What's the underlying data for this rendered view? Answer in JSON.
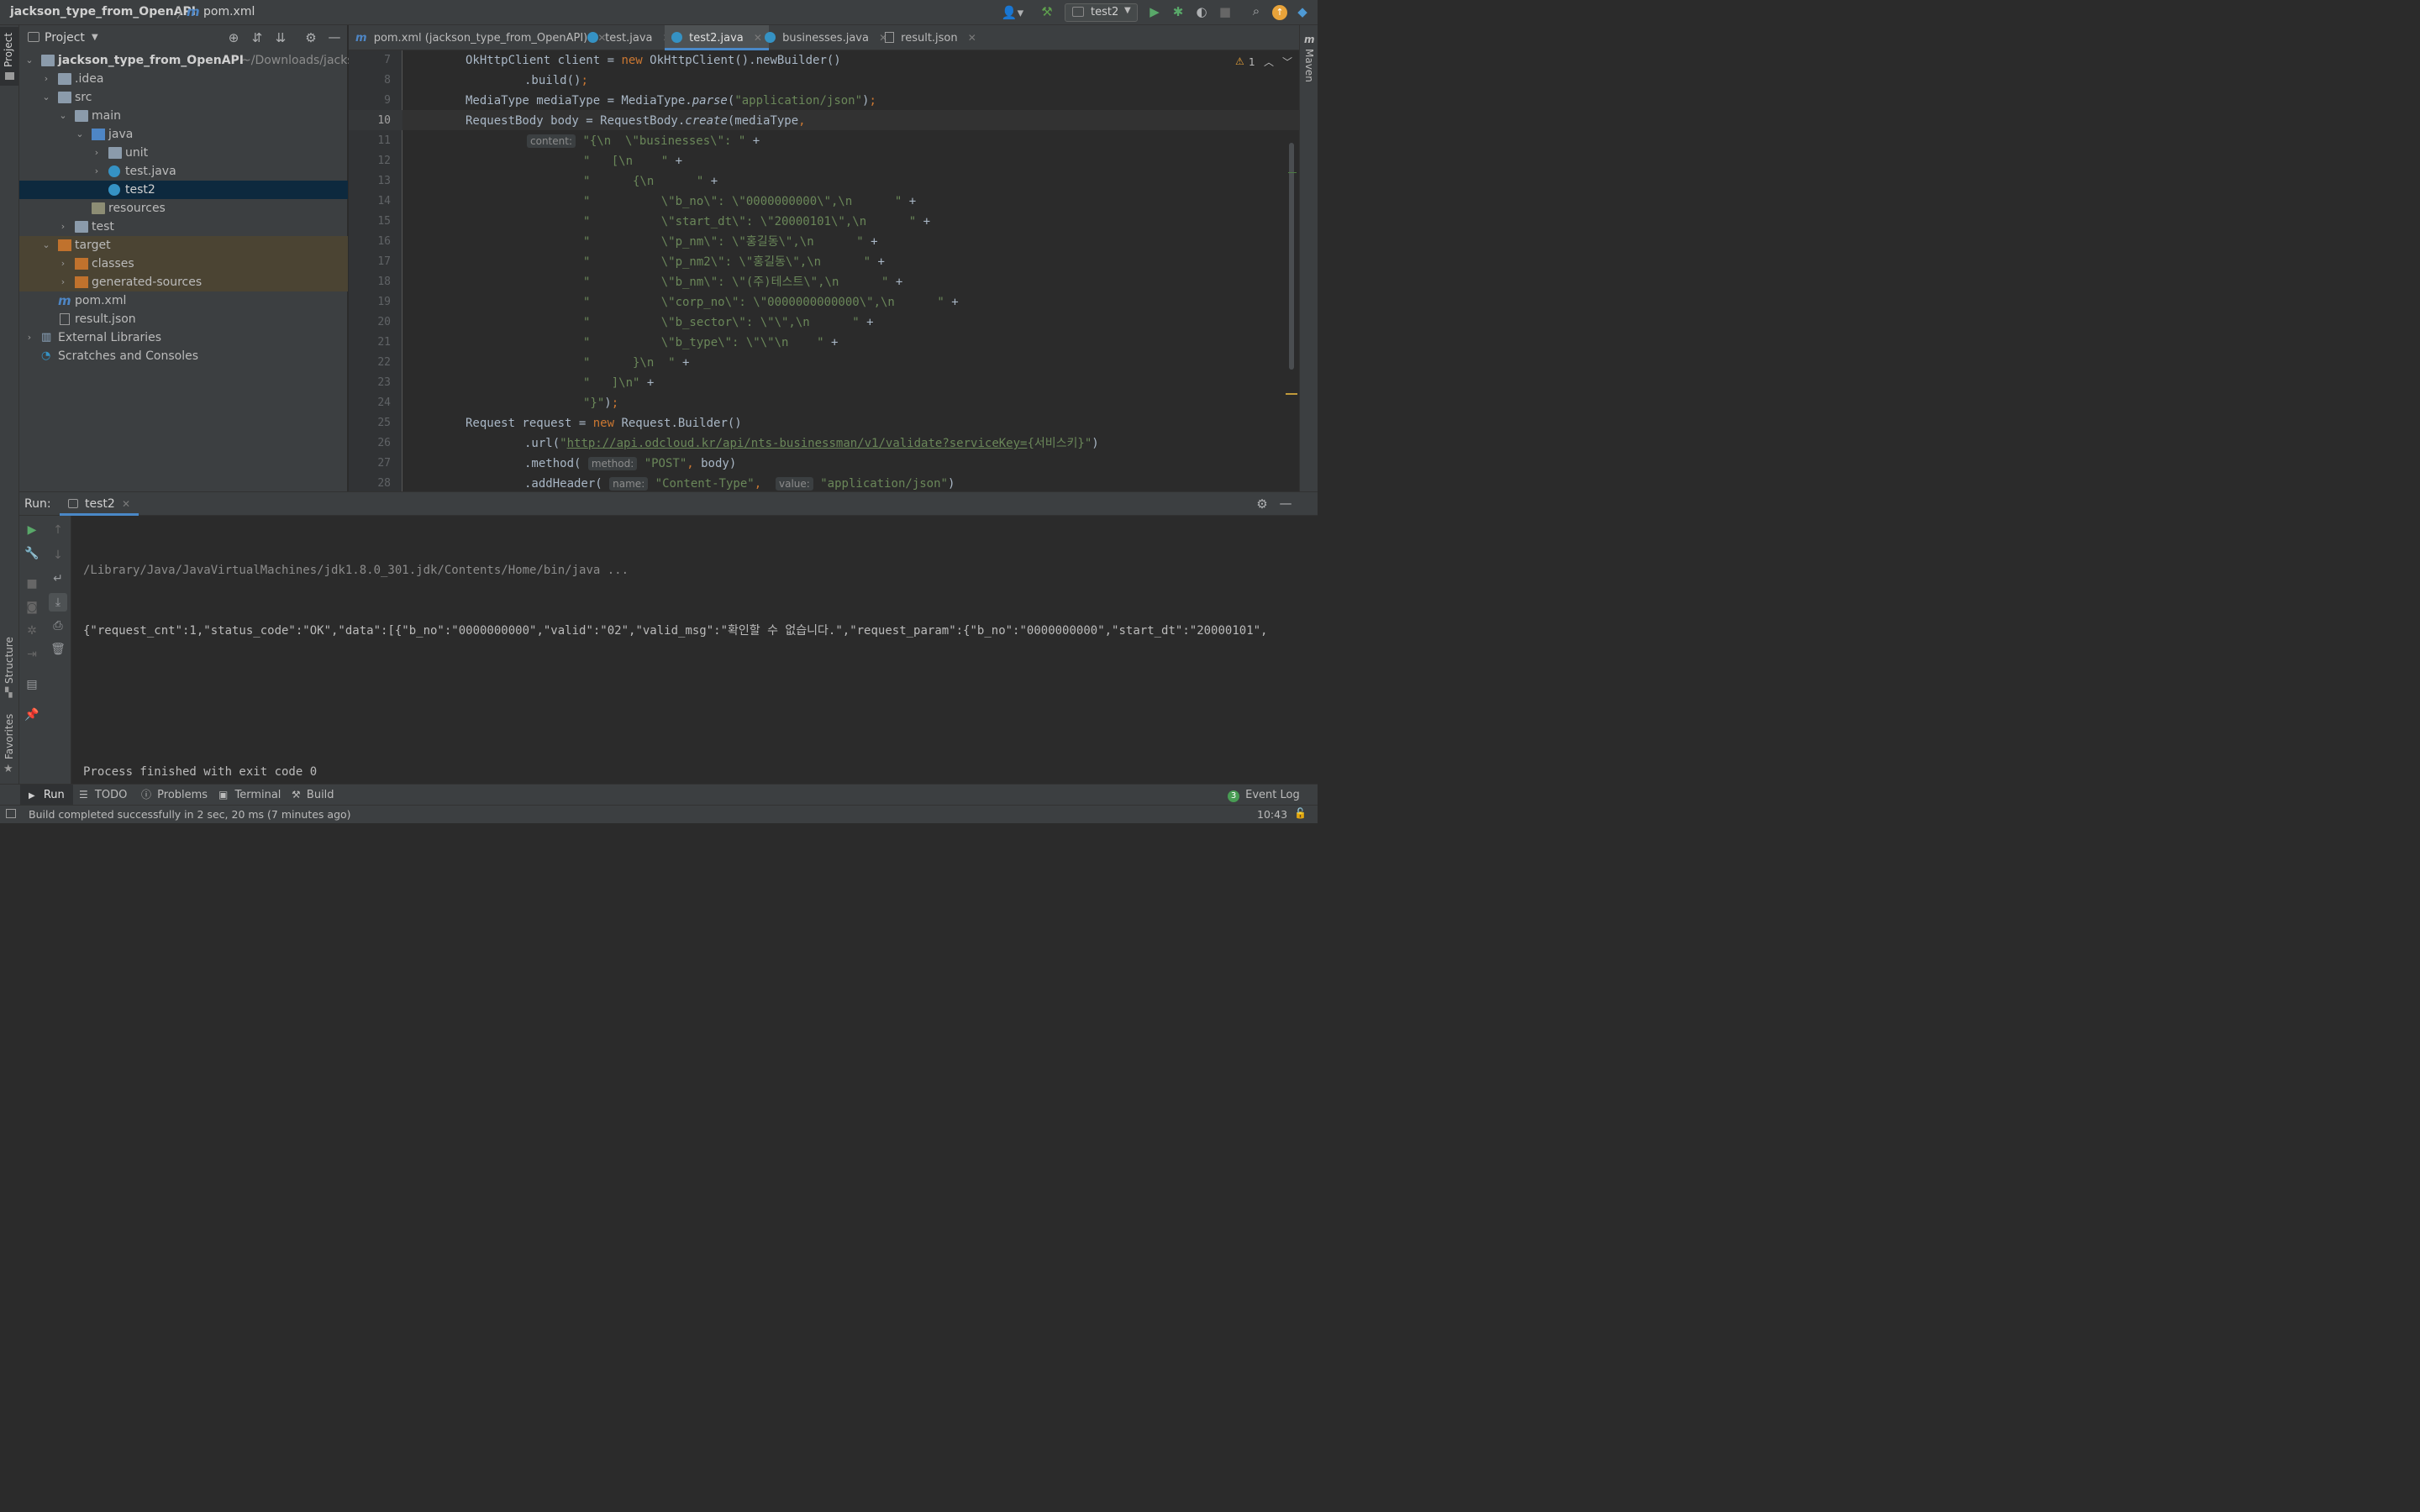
{
  "titlebar": {
    "project": "jackson_type_from_OpenAPI",
    "file": "pom.xml",
    "run_config": "test2"
  },
  "left_strip": {
    "project": "Project",
    "structure": "Structure",
    "favorites": "Favorites"
  },
  "right_strip": {
    "maven": "Maven"
  },
  "project_panel": {
    "title": "Project",
    "tree": [
      {
        "label": "jackson_type_from_OpenAPI",
        "hint": "~/Downloads/jacks",
        "icon": "module-folder-icon"
      },
      {
        "label": ".idea",
        "icon": "folder-icon"
      },
      {
        "label": "src",
        "icon": "folder-icon"
      },
      {
        "label": "main",
        "icon": "folder-icon"
      },
      {
        "label": "java",
        "icon": "source-folder-icon"
      },
      {
        "label": "unit",
        "icon": "package-icon"
      },
      {
        "label": "test.java",
        "icon": "java-class-icon"
      },
      {
        "label": "test2",
        "icon": "java-class-icon"
      },
      {
        "label": "resources",
        "icon": "resources-folder-icon"
      },
      {
        "label": "test",
        "icon": "folder-icon"
      },
      {
        "label": "target",
        "icon": "excluded-folder-icon"
      },
      {
        "label": "classes",
        "icon": "excluded-folder-icon"
      },
      {
        "label": "generated-sources",
        "icon": "excluded-folder-icon"
      },
      {
        "label": "pom.xml",
        "icon": "maven-icon"
      },
      {
        "label": "result.json",
        "icon": "json-file-icon"
      },
      {
        "label": "External Libraries",
        "icon": "libraries-icon"
      },
      {
        "label": "Scratches and Consoles",
        "icon": "scratches-icon"
      }
    ]
  },
  "tabs": [
    {
      "label": "pom.xml (jackson_type_from_OpenAPI)"
    },
    {
      "label": "test.java"
    },
    {
      "label": "test2.java"
    },
    {
      "label": "businesses.java"
    },
    {
      "label": "result.json"
    }
  ],
  "editor": {
    "warning_count": "1",
    "line_numbers": [
      "7",
      "8",
      "9",
      "10",
      "11",
      "12",
      "13",
      "14",
      "15",
      "16",
      "17",
      "18",
      "19",
      "20",
      "21",
      "22",
      "23",
      "24",
      "25",
      "26",
      "27",
      "28"
    ],
    "hints": {
      "content": "content:",
      "method": "method:",
      "name": "name:",
      "value": "value:"
    },
    "strings": {
      "l9": "\"application/json\"",
      "l11": "\"{\\n  \\\"businesses\\\": \"",
      "l12": "\"   [\\n    \"",
      "l13": "\"      {\\n      \"",
      "l14": "\"          \\\"b_no\\\": \\\"0000000000\\\",\\n      \"",
      "l15": "\"          \\\"start_dt\\\": \\\"20000101\\\",\\n      \"",
      "l16": "\"          \\\"p_nm\\\": \\\"홍길동\\\",\\n      \"",
      "l17": "\"          \\\"p_nm2\\\": \\\"홍길동\\\",\\n      \"",
      "l18": "\"          \\\"b_nm\\\": \\\"(주)테스트\\\",\\n      \"",
      "l19": "\"          \\\"corp_no\\\": \\\"0000000000000\\\",\\n      \"",
      "l20": "\"          \\\"b_sector\\\": \\\"\\\",\\n      \"",
      "l21": "\"          \\\"b_type\\\": \\\"\\\"\\n    \"",
      "l22": "\"      }\\n  \"",
      "l23": "\"   ]\\n\"",
      "l24": "\"}\"",
      "l26_url": "http://api.odcloud.kr/api/nts-businessman/v1/validate?serviceKey=",
      "l26_key": "{서비스키}",
      "l27": "\"POST\"",
      "l28a": "\"Content-Type\"",
      "l28b": "\"application/json\""
    }
  },
  "run_panel": {
    "label": "Run:",
    "tab": "test2",
    "output": [
      "/Library/Java/JavaVirtualMachines/jdk1.8.0_301.jdk/Contents/Home/bin/java ...",
      "{\"request_cnt\":1,\"status_code\":\"OK\",\"data\":[{\"b_no\":\"0000000000\",\"valid\":\"02\",\"valid_msg\":\"확인할 수 없습니다.\",\"request_param\":{\"b_no\":\"0000000000\",\"start_dt\":\"20000101\",",
      "",
      "",
      "Process finished with exit code 0"
    ]
  },
  "bottom_tabs": [
    {
      "label": "Run"
    },
    {
      "label": "TODO"
    },
    {
      "label": "Problems"
    },
    {
      "label": "Terminal"
    },
    {
      "label": "Build"
    }
  ],
  "event_log": {
    "count": "3",
    "label": "Event Log"
  },
  "status": {
    "message": "Build completed successfully in 2 sec, 20 ms (7 minutes ago)",
    "time": "10:43"
  },
  "colors": {
    "accent": "#4e86c5",
    "selection": "#0d293e",
    "excluded": "#4b4433",
    "keyword": "#cc7832",
    "string": "#6a8759"
  }
}
